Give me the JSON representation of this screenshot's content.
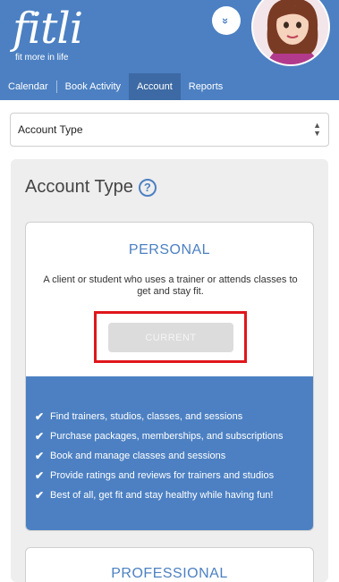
{
  "brand": {
    "logo_text": "fitli",
    "tagline": "fit more in life"
  },
  "header": {
    "collapse_icon": "chevron-double-down-icon",
    "collapse_glyph": "»"
  },
  "nav": {
    "tabs": [
      {
        "label": "Calendar",
        "active": false
      },
      {
        "label": "Book Activity",
        "active": false
      },
      {
        "label": "Account",
        "active": true
      },
      {
        "label": "Reports",
        "active": false
      }
    ]
  },
  "account_select": {
    "value": "Account Type",
    "arrow_up": "▲",
    "arrow_down": "▼"
  },
  "section": {
    "title": "Account Type",
    "help_glyph": "?"
  },
  "plans": [
    {
      "name": "PERSONAL",
      "description": "A client or student who uses a trainer or attends classes to get and stay fit.",
      "button_label": "CURRENT",
      "check_glyph": "✔",
      "features": [
        "Find trainers, studios, classes, and sessions",
        "Purchase packages, memberships, and subscriptions",
        "Book and manage classes and sessions",
        "Provide ratings and reviews for trainers and studios",
        "Best of all, get fit and stay healthy while having fun!"
      ]
    },
    {
      "name": "PROFESSIONAL"
    }
  ],
  "colors": {
    "brand_blue": "#4c80c2",
    "active_tab": "#3d6aa4",
    "highlight_red": "#e0161c"
  }
}
